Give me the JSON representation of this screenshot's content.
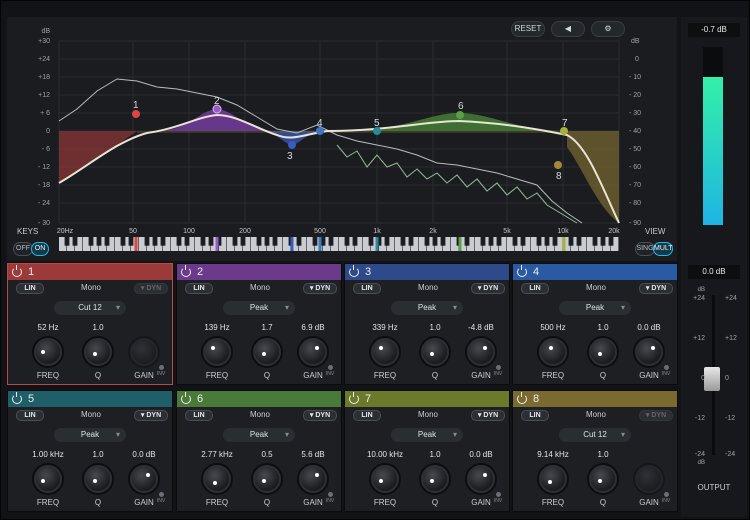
{
  "header": {
    "reset_label": "RESET",
    "speaker_icon": "speaker-icon",
    "settings_icon": "gear-icon"
  },
  "graph": {
    "db_unit": "dB",
    "left_scale": [
      "+30",
      "+24",
      "+18",
      "+ 6",
      "0",
      "- 6",
      "- 12",
      "- 18",
      "- 24",
      "- 30"
    ],
    "left_scale_extra": "+12",
    "right_scale": [
      "0",
      "- 10",
      "- 20",
      "- 30",
      "- 40",
      "- 50",
      "- 60",
      "- 70",
      "- 80",
      "- 90"
    ],
    "freq_ticks": [
      "20Hz",
      "50",
      "100",
      "200",
      "500",
      "1k",
      "2k",
      "5k",
      "10k",
      "20k"
    ],
    "points": [
      "1",
      "2",
      "3",
      "4",
      "5",
      "6",
      "7",
      "8"
    ],
    "keys_label": "KEYS",
    "keys_off": "OFF",
    "keys_on": "ON",
    "view_label": "VIEW",
    "view_sing": "SING",
    "view_mult": "MULT"
  },
  "colors": {
    "band1": "#9c3a3a",
    "band2": "#6b3a8a",
    "band3": "#2f4a8a",
    "band4": "#2a5aa3",
    "band5": "#1f5f6a",
    "band6": "#4a7a3a",
    "band7": "#6a7a2a",
    "band8": "#7a6a30",
    "accent": "#29b6e6",
    "meter": "#33e0c0"
  },
  "bands": [
    {
      "num": "1",
      "lin": "LIN",
      "mono": "Mono",
      "dyn": "DYN",
      "type": "Cut 12",
      "freq": "52 Hz",
      "q": "1.0",
      "gain": "",
      "freq_lbl": "FREQ",
      "q_lbl": "Q",
      "gain_lbl": "GAIN",
      "inv": "INV"
    },
    {
      "num": "2",
      "lin": "LIN",
      "mono": "Mono",
      "dyn": "DYN",
      "type": "Peak",
      "freq": "139 Hz",
      "q": "1.7",
      "gain": "6.9 dB",
      "freq_lbl": "FREQ",
      "q_lbl": "Q",
      "gain_lbl": "GAIN",
      "inv": "INV"
    },
    {
      "num": "3",
      "lin": "LIN",
      "mono": "Mono",
      "dyn": "DYN",
      "type": "Peak",
      "freq": "339 Hz",
      "q": "1.0",
      "gain": "-4.8 dB",
      "freq_lbl": "FREQ",
      "q_lbl": "Q",
      "gain_lbl": "GAIN",
      "inv": "INV"
    },
    {
      "num": "4",
      "lin": "LIN",
      "mono": "Mono",
      "dyn": "DYN",
      "type": "Peak",
      "freq": "500 Hz",
      "q": "1.0",
      "gain": "0.0 dB",
      "freq_lbl": "FREQ",
      "q_lbl": "Q",
      "gain_lbl": "GAIN",
      "inv": "INV"
    },
    {
      "num": "5",
      "lin": "LIN",
      "mono": "Mono",
      "dyn": "DYN",
      "type": "Peak",
      "freq": "1.00 kHz",
      "q": "1.0",
      "gain": "0.0 dB",
      "freq_lbl": "FREQ",
      "q_lbl": "Q",
      "gain_lbl": "GAIN",
      "inv": "INV"
    },
    {
      "num": "6",
      "lin": "LIN",
      "mono": "Mono",
      "dyn": "DYN",
      "type": "Peak",
      "freq": "2.77 kHz",
      "q": "0.5",
      "gain": "5.6 dB",
      "freq_lbl": "FREQ",
      "q_lbl": "Q",
      "gain_lbl": "GAIN",
      "inv": "INV"
    },
    {
      "num": "7",
      "lin": "LIN",
      "mono": "Mono",
      "dyn": "DYN",
      "type": "Peak",
      "freq": "10.00 kHz",
      "q": "1.0",
      "gain": "0.0 dB",
      "freq_lbl": "FREQ",
      "q_lbl": "Q",
      "gain_lbl": "GAIN",
      "inv": "INV"
    },
    {
      "num": "8",
      "lin": "LIN",
      "mono": "Mono",
      "dyn": "DYN",
      "type": "Cut 12",
      "freq": "9.14 kHz",
      "q": "1.0",
      "gain": "",
      "freq_lbl": "FREQ",
      "q_lbl": "Q",
      "gain_lbl": "GAIN",
      "inv": "INV"
    }
  ],
  "output": {
    "peak_readout": "-0.7 dB",
    "gain_readout": "0.0 dB",
    "scale": [
      "+24",
      "dB",
      "+12",
      "0",
      "-12",
      "-24",
      "dB"
    ],
    "label": "OUTPUT",
    "meter_level": 0.83
  }
}
